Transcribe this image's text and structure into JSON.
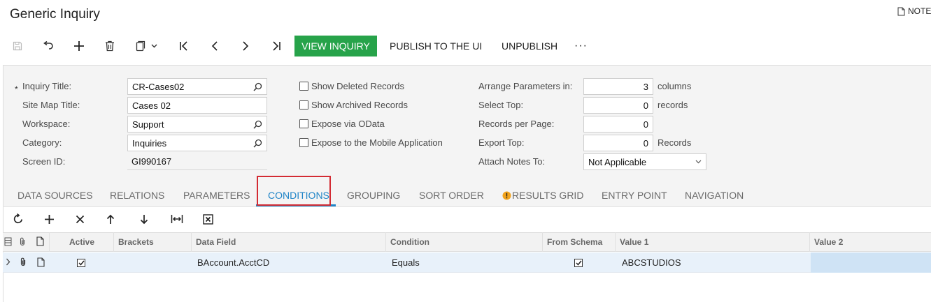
{
  "header": {
    "title": "Generic Inquiry",
    "notes_label": "NOTE"
  },
  "toolbar": {
    "icons": [
      "save-icon",
      "undo-icon",
      "add-icon",
      "delete-icon",
      "copy-paste-icon",
      "first-record-icon",
      "previous-record-icon",
      "next-record-icon",
      "last-record-icon"
    ],
    "view_inquiry_label": "VIEW INQUIRY",
    "publish_label": "PUBLISH TO THE UI",
    "unpublish_label": "UNPUBLISH",
    "more_label": "···"
  },
  "form": {
    "required_mark": "*",
    "inquiry_title_label": "Inquiry Title:",
    "inquiry_title_value": "CR-Cases02",
    "site_map_title_label": "Site Map Title:",
    "site_map_title_value": "Cases 02",
    "workspace_label": "Workspace:",
    "workspace_value": "Support",
    "category_label": "Category:",
    "category_value": "Inquiries",
    "screen_id_label": "Screen ID:",
    "screen_id_value": "GI990167",
    "show_deleted_label": "Show Deleted Records",
    "show_archived_label": "Show Archived Records",
    "expose_odata_label": "Expose via OData",
    "expose_mobile_label": "Expose to the Mobile Application",
    "arrange_params_label": "Arrange Parameters in:",
    "arrange_params_value": "3",
    "arrange_params_unit": "columns",
    "select_top_label": "Select Top:",
    "select_top_value": "0",
    "select_top_unit": "records",
    "records_per_page_label": "Records per Page:",
    "records_per_page_value": "0",
    "export_top_label": "Export Top:",
    "export_top_value": "0",
    "export_top_unit": "Records",
    "attach_notes_label": "Attach Notes To:",
    "attach_notes_value": "Not Applicable"
  },
  "tabs": [
    {
      "label": "DATA SOURCES"
    },
    {
      "label": "RELATIONS"
    },
    {
      "label": "PARAMETERS"
    },
    {
      "label": "CONDITIONS",
      "active": true
    },
    {
      "label": "GROUPING"
    },
    {
      "label": "SORT ORDER"
    },
    {
      "label": "RESULTS GRID",
      "warning": true
    },
    {
      "label": "ENTRY POINT"
    },
    {
      "label": "NAVIGATION"
    }
  ],
  "grid_toolbar": {
    "icons": [
      "refresh-icon",
      "add-row-icon",
      "delete-row-icon",
      "move-up-icon",
      "move-down-icon",
      "fit-columns-icon",
      "export-excel-icon"
    ]
  },
  "grid": {
    "columns": [
      "Active",
      "Brackets",
      "Data Field",
      "Condition",
      "From Schema",
      "Value 1",
      "Value 2"
    ],
    "rows": [
      {
        "active": true,
        "brackets": "",
        "data_field": "BAccount.AcctCD",
        "condition": "Equals",
        "from_schema": true,
        "value1": "ABCSTUDIOS",
        "value2": ""
      }
    ]
  },
  "colors": {
    "primary_button": "#27a34a",
    "active_tab": "#1f84c7",
    "highlight_box": "#d32b33",
    "selected_row": "#e8f1fa",
    "selected_cell": "#cfe3f5"
  }
}
